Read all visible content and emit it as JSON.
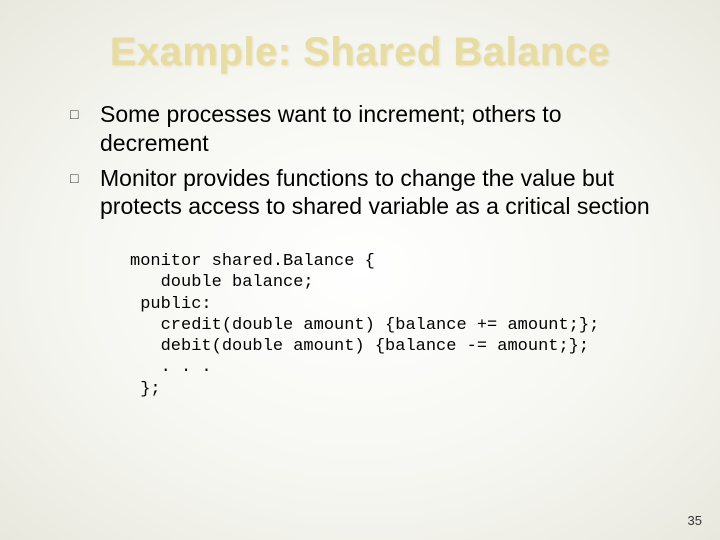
{
  "title": "Example: Shared Balance",
  "bullets": [
    "Some processes want to increment; others to decrement",
    "Monitor provides functions to change the value but protects access to shared variable as a critical section"
  ],
  "code": "monitor shared.Balance {\n   double balance;\n public:\n   credit(double amount) {balance += amount;};\n   debit(double amount) {balance -= amount;};\n   . . .\n };",
  "page_number": "35"
}
